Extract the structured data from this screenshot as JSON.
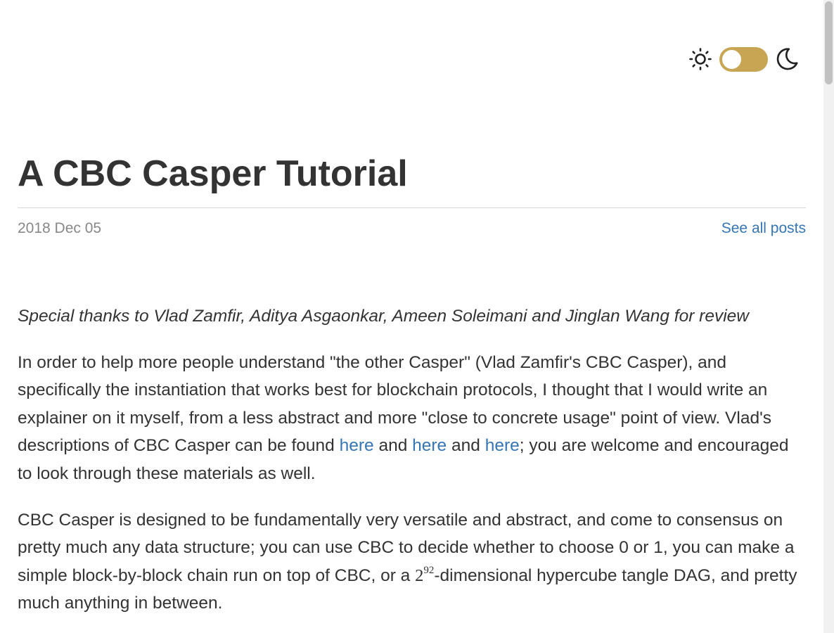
{
  "theme": {
    "sun_icon": "sun-icon",
    "moon_icon": "moon-icon",
    "toggle_color": "#c8a552",
    "mode": "light"
  },
  "post": {
    "title": "A CBC Casper Tutorial",
    "date": "2018 Dec 05",
    "see_all_posts": "See all posts"
  },
  "paragraphs": {
    "thanks": "Special thanks to Vlad Zamfir, Aditya Asgaonkar, Ameen Soleimani and Jinglan Wang for review",
    "p1_text_a": "In order to help more people understand \"the other Casper\" (Vlad Zamfir's CBC Casper), and specifically the instantiation that works best for blockchain protocols, I thought that I would write an explainer on it myself, from a less abstract and more \"close to concrete usage\" point of view. Vlad's descriptions of CBC Casper can be found ",
    "p1_link_1": "here",
    "p1_text_b": " and ",
    "p1_link_2": "here",
    "p1_text_c": " and ",
    "p1_link_3": "here",
    "p1_text_d": "; you are welcome and encouraged to look through these materials as well.",
    "p2_text_a": "CBC Casper is designed to be fundamentally very versatile and abstract, and come to consensus on pretty much any data structure; you can use CBC to decide whether to choose 0 or 1, you can make a simple block-by-block chain run on top of CBC, or a ",
    "p2_math_base": "2",
    "p2_math_exp": "92",
    "p2_text_b": "-dimensional hypercube tangle DAG, and pretty much anything in between."
  },
  "colors": {
    "link": "#3576b6",
    "text": "#333333",
    "date": "#888888"
  }
}
